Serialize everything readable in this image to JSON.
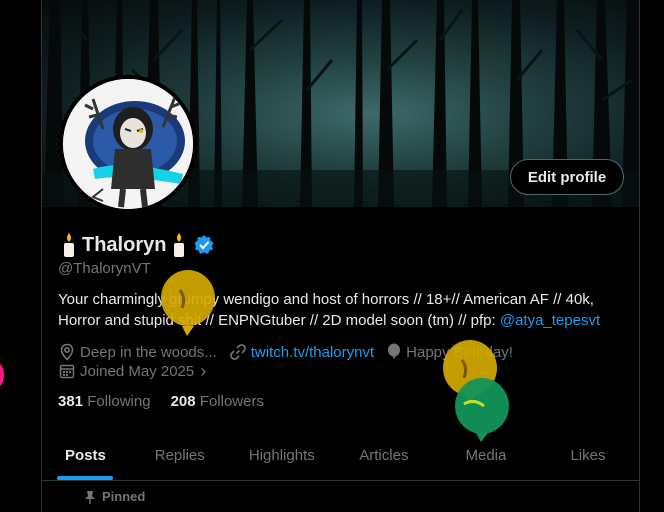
{
  "profile": {
    "display_name": "Thaloryn",
    "handle": "@ThalorynVT",
    "edit_button": "Edit profile",
    "bio_text": "Your charmingly grumpy wendigo and host of horrors // 18+// American AF // 40k, Horror and stupid shit // ENPNGtuber // 2D model soon (tm) // pfp: ",
    "bio_mention": "@atya_tepesvt",
    "location": "Deep in the woods...",
    "website": "twitch.tv/thalorynvt",
    "birthday": "Happy Birthday!",
    "joined": "Joined May 2025",
    "following_count": "381",
    "following_label": "Following",
    "followers_count": "208",
    "followers_label": "Followers"
  },
  "tabs": [
    {
      "label": "Posts",
      "active": true
    },
    {
      "label": "Replies"
    },
    {
      "label": "Highlights"
    },
    {
      "label": "Articles"
    },
    {
      "label": "Media"
    },
    {
      "label": "Likes"
    }
  ],
  "pinned_label": "Pinned",
  "colors": {
    "accent": "#1d9bf0",
    "text": "#e7e9ea",
    "muted": "#71767b",
    "border": "#2f3336",
    "balloon_yellow": "#d4a900",
    "balloon_green": "#13935a"
  },
  "icons": [
    "location-icon",
    "link-icon",
    "balloon-icon",
    "calendar-icon",
    "verified-badge-icon",
    "pin-icon",
    "candle-icon"
  ]
}
